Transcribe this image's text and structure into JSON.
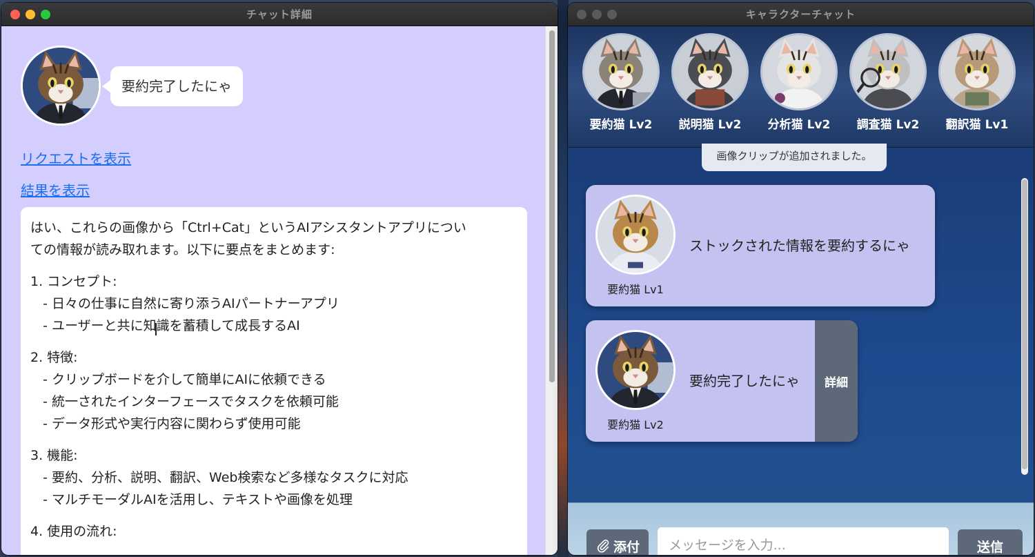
{
  "left_window": {
    "title": "チャット詳細",
    "speech": "要約完了したにゃ",
    "links": {
      "request": "リクエストを表示",
      "result": "結果を表示"
    },
    "result_lines": [
      "はい、これらの画像から「Ctrl+Cat」というAIアシスタントアプリについ",
      "ての情報が読み取れます。以下に要点をまとめます:",
      "1. コンセプト:",
      "   - 日々の仕事に自然に寄り添うAIパートナーアプリ",
      "   - ユーザーと共に知識を蓄積して成長するAI",
      "2. 特徴:",
      "   - クリップボードを介して簡単にAIに依頼できる",
      "   - 統一されたインターフェースでタスクを依頼可能",
      "   - データ形式や実行内容に関わらず使用可能",
      "3. 機能:",
      "   - 要約、分析、説明、翻訳、Web検索など多様なタスクに対応",
      "   - マルチモーダルAIを活用し、テキストや画像を処理",
      "4. 使用の流れ:"
    ]
  },
  "right_window": {
    "title": "キャラクターチャット",
    "characters": [
      {
        "name": "要約猫 Lv2"
      },
      {
        "name": "説明猫 Lv2"
      },
      {
        "name": "分析猫 Lv2"
      },
      {
        "name": "調査猫 Lv2"
      },
      {
        "name": "翻訳猫 Lv1"
      }
    ],
    "system_message": "画像クリップが追加されました。",
    "messages": [
      {
        "sender": "要約猫 Lv1",
        "text": "ストックされた情報を要約するにゃ"
      },
      {
        "sender": "要約猫 Lv2",
        "text": "要約完了したにゃ",
        "detail_label": "詳細"
      }
    ],
    "input": {
      "attach_label": "添付",
      "placeholder": "メッセージを入力...",
      "send_label": "送信"
    }
  },
  "colors": {
    "left_bg": "#d4ceff",
    "chat_bg": "#1d4a8e",
    "card_bg": "#c4c2f0",
    "button_bg": "#5d6978",
    "link": "#1a6ef0"
  }
}
